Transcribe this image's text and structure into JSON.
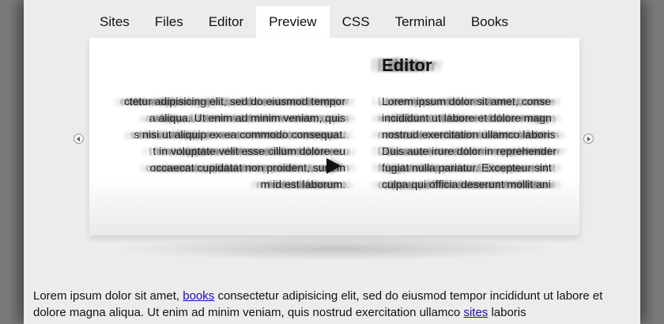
{
  "tabs": [
    {
      "label": "Sites",
      "active": false
    },
    {
      "label": "Files",
      "active": false
    },
    {
      "label": "Editor",
      "active": false
    },
    {
      "label": "Preview",
      "active": true
    },
    {
      "label": "CSS",
      "active": false
    },
    {
      "label": "Terminal",
      "active": false
    },
    {
      "label": "Books",
      "active": false
    }
  ],
  "slideshow": {
    "slide_title": "Editor",
    "left_column": [
      "ctetur adipisicing elit, sed do eiusmod tempor",
      "a aliqua. Ut enim ad minim veniam, quis",
      "s nisi ut aliquip ex ea commodo consequat.",
      "t in voluptate velit esse cillum dolore eu",
      "occaecat cupidatat non proident, sunt in",
      "m id est laborum."
    ],
    "right_column": [
      "Lorem ipsum dolor sit amet, conse",
      "incididunt ut labore et dolore magn",
      "nostrud exercitation ullamco laboris",
      "Duis aute irure dolor in reprehender",
      "fugiat nulla pariatur. Excepteur sint",
      "culpa qui officia deserunt mollit ani"
    ],
    "play_icon": "play-icon",
    "prev_icon": "arrow-left-icon",
    "next_icon": "arrow-right-icon"
  },
  "body": {
    "p1": "Lorem ipsum dolor sit amet, ",
    "link1": "books",
    "p2": " consectetur adipisicing elit, sed do eiusmod tempor incididunt ut labore et dolore magna aliqua. Ut enim ad minim veniam, quis nostrud exercitation ullamco ",
    "link2": "sites",
    "p3": " laboris"
  },
  "colors": {
    "background": "#7a7a7a",
    "page": "#ececec",
    "active_tab": "#ffffff",
    "link": "#1a0dab"
  }
}
